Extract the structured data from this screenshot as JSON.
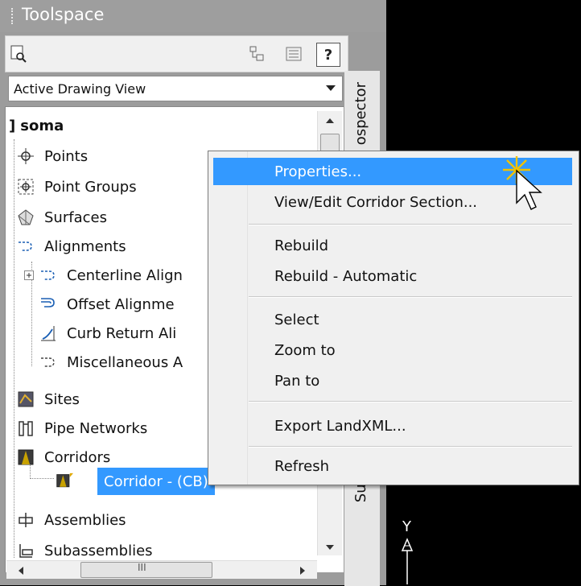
{
  "palette": {
    "highlight": "#3399ff",
    "panel": "#9c9c9c",
    "canvas": "#000000"
  },
  "toolspace": {
    "title": "Toolspace",
    "view_dropdown": {
      "selected": "Active Drawing View"
    },
    "side_tabs": {
      "top": "ospector",
      "bottom": "Sur"
    },
    "tree": {
      "root": "soma",
      "items": [
        {
          "label": "Points",
          "icon": "points-icon"
        },
        {
          "label": "Point Groups",
          "icon": "point-groups-icon"
        },
        {
          "label": "Surfaces",
          "icon": "surfaces-icon"
        },
        {
          "label": "Alignments",
          "icon": "alignments-icon"
        },
        {
          "label": "Centerline Align",
          "icon": "centerline-alignment-icon"
        },
        {
          "label": "Offset Alignme",
          "icon": "offset-alignment-icon"
        },
        {
          "label": "Curb Return Ali",
          "icon": "curb-return-alignment-icon"
        },
        {
          "label": "Miscellaneous A",
          "icon": "misc-alignment-icon"
        },
        {
          "label": "Sites",
          "icon": "sites-icon"
        },
        {
          "label": "Pipe Networks",
          "icon": "pipe-networks-icon"
        },
        {
          "label": "Corridors",
          "icon": "corridors-icon"
        },
        {
          "label": "Corridor - (CB)",
          "icon": "corridor-item-icon"
        },
        {
          "label": "Assemblies",
          "icon": "assemblies-icon"
        },
        {
          "label": "Subassemblies",
          "icon": "subassemblies-icon"
        }
      ],
      "hscroll_glyph": "III"
    }
  },
  "context_menu": {
    "items": [
      "Properties...",
      "View/Edit Corridor Section...",
      "Rebuild",
      "Rebuild - Automatic",
      "Select",
      "Zoom to",
      "Pan to",
      "Export LandXML...",
      "Refresh"
    ]
  },
  "canvas": {
    "axis_label": "Y"
  }
}
